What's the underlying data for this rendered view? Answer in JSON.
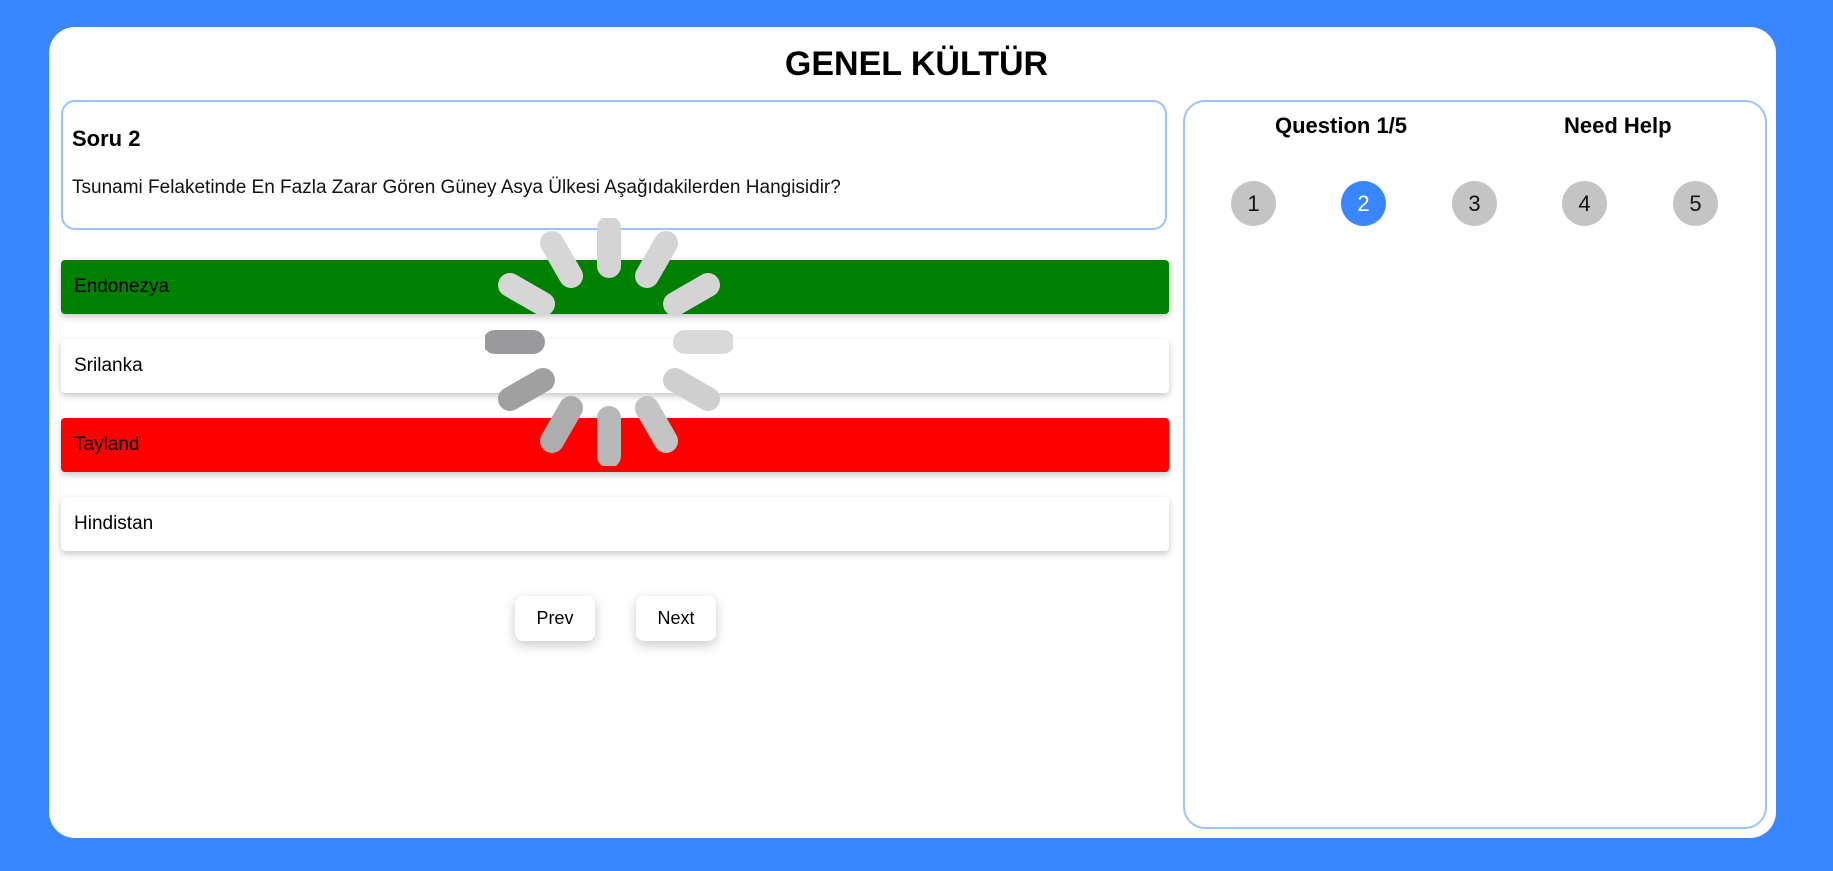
{
  "header": {
    "title": "GENEL KÜLTÜR"
  },
  "question": {
    "number_label": "Soru 2",
    "text": "Tsunami Felaketinde En Fazla Zarar Gören Güney Asya Ülkesi Aşağıdakilerden Hangisidir?"
  },
  "options": [
    {
      "label": "Endonezya",
      "state": "correct",
      "color": "#008000"
    },
    {
      "label": "Srilanka",
      "state": "neutral",
      "color": "#ffffff"
    },
    {
      "label": "Tayland",
      "state": "wrong",
      "color": "#ff0000"
    },
    {
      "label": "Hindistan",
      "state": "neutral",
      "color": "#ffffff"
    }
  ],
  "navigation": {
    "prev_label": "Prev",
    "next_label": "Next"
  },
  "sidebar": {
    "progress_label": "Question 1/5",
    "help_label": "Need Help",
    "question_numbers": [
      "1",
      "2",
      "3",
      "4",
      "5"
    ],
    "active_question": "2"
  },
  "loading_indicator": {
    "icon": "loading-spinner-icon",
    "visible": true
  },
  "colors": {
    "background": "#3a86ff",
    "accent": "#3a86ff",
    "correct": "#008000",
    "wrong": "#ff0000",
    "border": "#9cc2ff",
    "inactive_circle": "#c4c4c4"
  }
}
